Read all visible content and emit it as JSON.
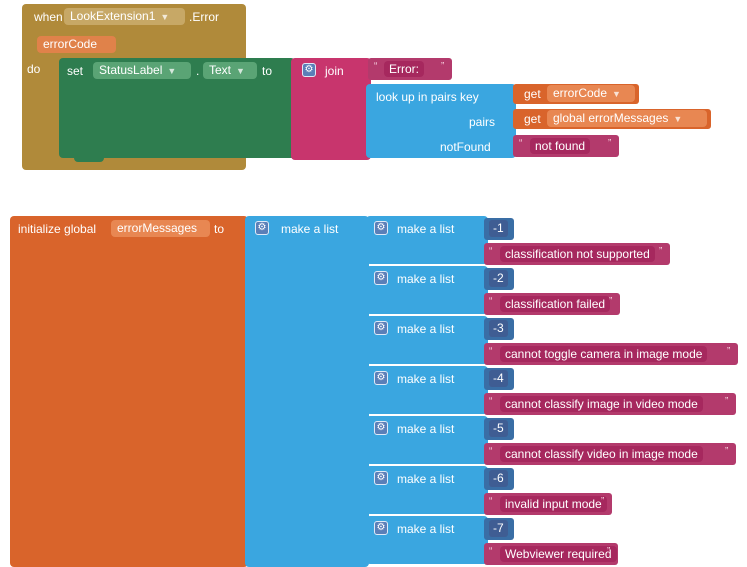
{
  "event": {
    "when": "when",
    "component": "LookExtension1",
    "event_name": ".Error",
    "param": "errorCode",
    "do": "do"
  },
  "set_block": {
    "set": "set",
    "component": "StatusLabel",
    "dot": ".",
    "property": "Text",
    "to": "to"
  },
  "join_block": {
    "label": "join",
    "error_text": "Error: "
  },
  "lookup_block": {
    "label": "look up in pairs  key",
    "pairs_label": "pairs",
    "not_found_label": "notFound",
    "get_key": "errorCode",
    "get_label": "get",
    "get_pairs": "global errorMessages",
    "not_found_text": "not found"
  },
  "init_block": {
    "label": "initialize global",
    "var_name": "errorMessages",
    "to": "to",
    "make_a_list": "make a list"
  },
  "error_pairs": [
    {
      "code": "-1",
      "message": "classification not supported"
    },
    {
      "code": "-2",
      "message": "classification failed"
    },
    {
      "code": "-3",
      "message": "cannot toggle camera in image mode"
    },
    {
      "code": "-4",
      "message": "cannot classify image in video mode"
    },
    {
      "code": "-5",
      "message": "cannot classify video in image mode"
    },
    {
      "code": "-6",
      "message": "invalid input mode"
    },
    {
      "code": "-7",
      "message": "Webviewer required"
    }
  ],
  "icons": {
    "gear": "gear-icon",
    "dropdown": "chevron-down-icon",
    "quote": "quote-icon"
  },
  "colors": {
    "event_block": "#b08a3a",
    "text_block": "#b33a6c",
    "list_block": "#3aa6e0",
    "variable_block": "#d9642b",
    "component_block": "#2e7d4f",
    "join_block": "#c8356d"
  }
}
